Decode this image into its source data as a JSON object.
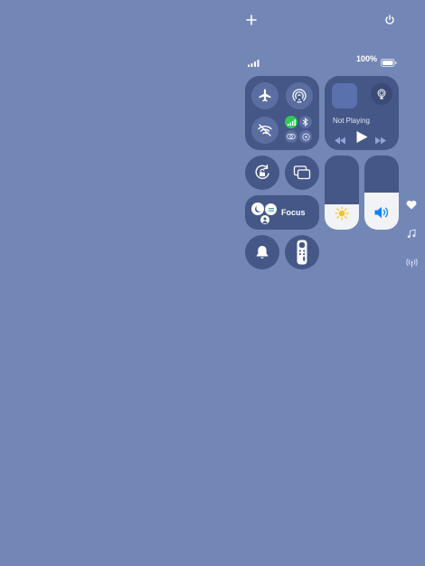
{
  "status": {
    "battery_text": "100%",
    "battery_level": 1.0,
    "signal_bars": 4
  },
  "media": {
    "now_playing": "Not Playing"
  },
  "focus": {
    "label": "Focus"
  },
  "sliders": {
    "brightness_level": 0.34,
    "volume_level": 0.5
  },
  "colors": {
    "background": "#7287b6",
    "panel": "#445787",
    "accent_green": "#34c759",
    "accent_blue": "#0a84ff"
  },
  "icons": {
    "top": [
      "plus-icon",
      "power-icon"
    ],
    "connectivity": [
      "airplane-icon",
      "airdrop-icon",
      "wifi-off-icon",
      "cellular-icon",
      "bluetooth-icon",
      "vpn-icon",
      "hotspot-icon"
    ],
    "side": [
      "heart-icon",
      "music-icon",
      "antenna-icon"
    ]
  }
}
